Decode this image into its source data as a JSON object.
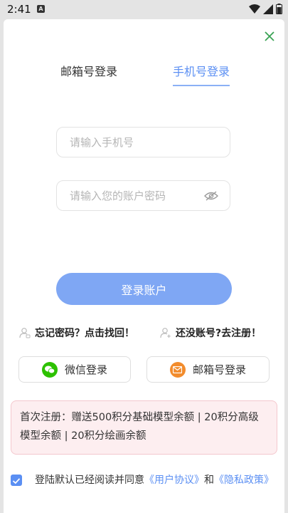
{
  "status_bar": {
    "time": "2:41",
    "badge": "A"
  },
  "tabs": {
    "email_login": "邮箱号登录",
    "phone_login": "手机号登录"
  },
  "form": {
    "phone_placeholder": "请输入手机号",
    "password_placeholder": "请输入您的账户密码"
  },
  "login_button": "登录账户",
  "links": {
    "forgot": "忘记密码？点击找回！",
    "register": "还没账号?去注册！"
  },
  "social": {
    "wechat": "微信登录",
    "email": "邮箱号登录"
  },
  "promo_text": "首次注册：赠送500积分基础模型余额 | 20积分高级模型余额 | 20积分绘画余额",
  "agreement": {
    "prefix": "登陆默认已经阅读并同意",
    "user_agreement": "《用户协议》",
    "and": "和",
    "privacy_policy": "《隐私政策》"
  },
  "colors": {
    "accent": "#5b8ff3",
    "button": "#7fa7f4",
    "wechat": "#2dc100",
    "mail": "#f28c2d",
    "promo_bg": "#fdeef0",
    "close": "#3aa354"
  }
}
